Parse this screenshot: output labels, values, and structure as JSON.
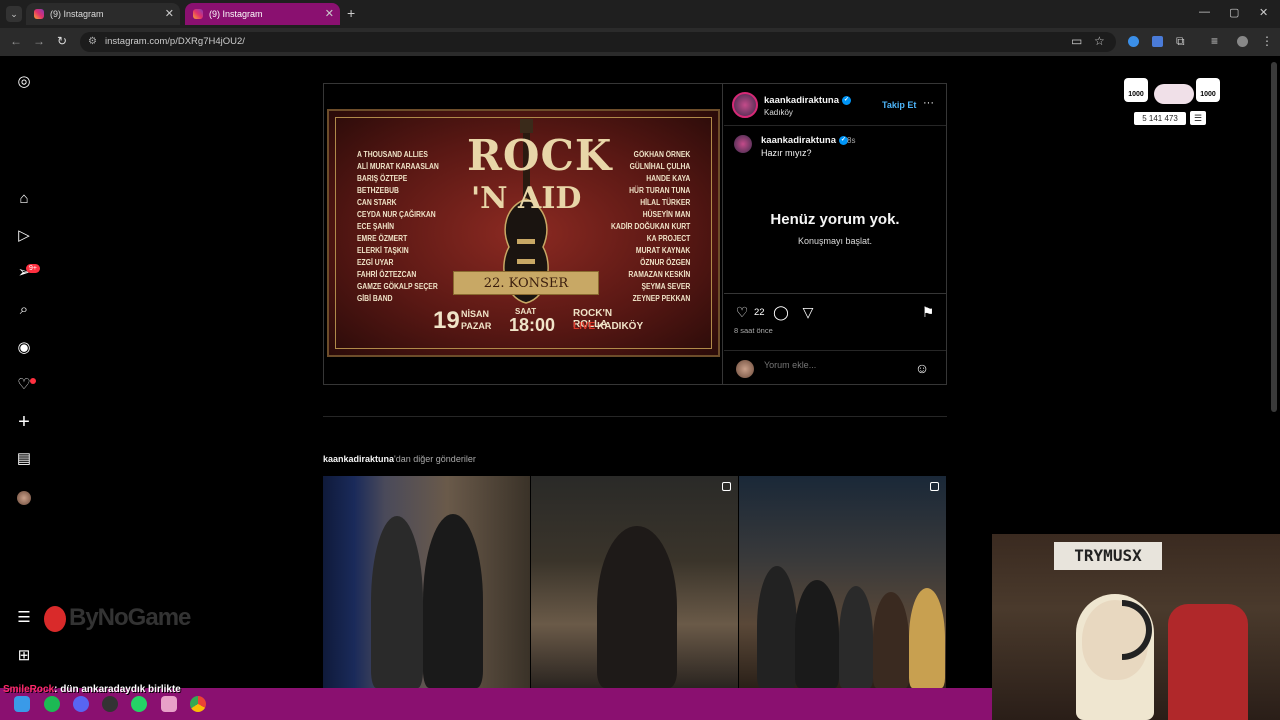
{
  "browser": {
    "tabs": [
      {
        "label": "(9) Instagram"
      },
      {
        "label": "(9) Instagram"
      }
    ],
    "new_tab": "+",
    "url": "instagram.com/p/DXRg7H4jOU2/",
    "window_controls": {
      "minimize": "—",
      "maximize": "▢",
      "close": "✕"
    }
  },
  "sidebar": {
    "notifications_badge": "9+"
  },
  "post": {
    "author": "kaankadiraktuna",
    "location": "Kadıköy",
    "follow_label": "Takip Et",
    "caption_author": "kaankadiraktuna",
    "caption_time": "8s",
    "caption_text": "Hazır mıyız?",
    "no_comments_title": "Henüz yorum yok.",
    "no_comments_sub": "Konuşmayı başlat.",
    "likes": "22",
    "time_ago": "8 saat önce",
    "comment_placeholder": "Yorum ekle..."
  },
  "poster": {
    "title1": "ROCK",
    "title2": "'N AID",
    "banner": "22. KONSER",
    "left_names": [
      "A THOUSAND ALLIES",
      "ALİ MURAT KARAASLAN",
      "BARIŞ ÖZTEPE",
      "BETHZEBUB",
      "CAN STARK",
      "CEYDA NUR ÇAĞIRKAN",
      "ECE ŞAHİN",
      "EMRE ÖZMERT",
      "ELERKİ TAŞKIN",
      "EZGİ UYAR",
      "FAHRİ ÖZTEZCAN",
      "GAMZE GÖKALP SEÇER",
      "GİBİ BAND"
    ],
    "right_names": [
      "GÖKHAN ÖRNEK",
      "GÜLNİHAL ÇULHA",
      "HANDE KAYA",
      "HÜR TURAN TUNA",
      "HİLAL TÜRKER",
      "HÜSEYİN MAN",
      "KADİR DOĞUKAN KURT",
      "KA PROJECT",
      "MURAT KAYNAK",
      "ÖZNUR ÖZGEN",
      "RAMAZAN KESKİN",
      "ŞEYMA SEVER",
      "ZEYNEP PEKKAN"
    ],
    "day": "19",
    "month": "NİSAN",
    "weekday": "PAZAR",
    "time_label": "SAAT",
    "time": "18:00",
    "venue1": "ROCK'N ROLLA",
    "venue2a": "LIVE",
    "venue2b": "KADIKÖY"
  },
  "more_posts": {
    "username": "kaankadiraktuna",
    "suffix": "'dan diğer gönderiler"
  },
  "overlay": {
    "brand": "ByNoGame",
    "chat_nick": "SmileRock",
    "chat_msg": ": dün ankaradaydık birlikte",
    "webcam_sign": "TRYMUSX",
    "widget_left": "1000",
    "widget_right": "1000",
    "widget_count": "5 141 473",
    "widget_menu": "☰"
  },
  "colors": {
    "accent_blue": "#0095f6",
    "follow_blue": "#4db5f9",
    "taskbar": "#8a1070",
    "badge_red": "#ff3040"
  }
}
